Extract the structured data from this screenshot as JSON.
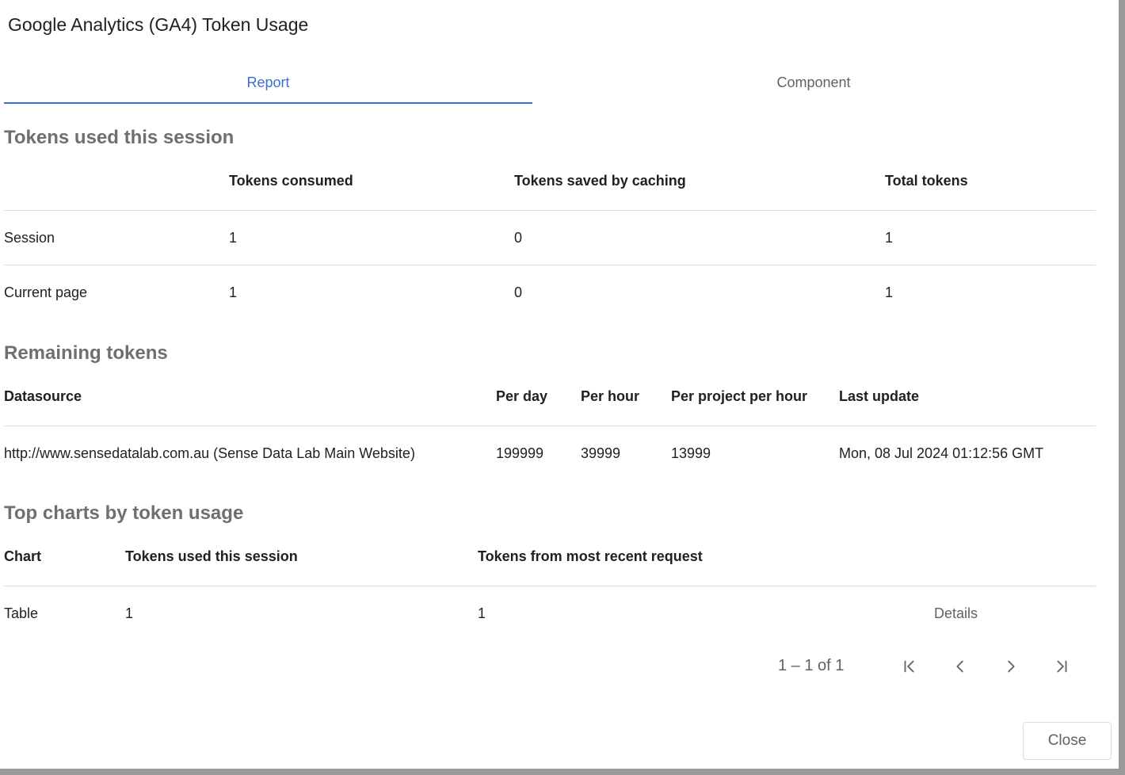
{
  "dialog": {
    "title": "Google Analytics (GA4) Token Usage"
  },
  "tabs": [
    {
      "label": "Report",
      "active": true
    },
    {
      "label": "Component",
      "active": false
    }
  ],
  "session_section": {
    "title": "Tokens used this session",
    "headers": [
      "",
      "Tokens consumed",
      "Tokens saved by caching",
      "Total tokens"
    ],
    "rows": [
      [
        "Session",
        "1",
        "0",
        "1"
      ],
      [
        "Current page",
        "1",
        "0",
        "1"
      ]
    ]
  },
  "remaining_section": {
    "title": "Remaining tokens",
    "headers": [
      "Datasource",
      "Per day",
      "Per hour",
      "Per project per hour",
      "Last update"
    ],
    "rows": [
      [
        "http://www.sensedatalab.com.au (Sense Data Lab Main Website)",
        "199999",
        "39999",
        "13999",
        "Mon, 08 Jul 2024 01:12:56 GMT"
      ]
    ]
  },
  "charts_section": {
    "title": "Top charts by token usage",
    "headers": [
      "Chart",
      "Tokens used this session",
      "Tokens from most recent request"
    ],
    "rows": [
      {
        "chart": "Table",
        "session": "1",
        "recent": "1",
        "action": "Details"
      }
    ]
  },
  "pagination": {
    "range_text": "1 – 1 of 1"
  },
  "footer": {
    "close_label": "Close"
  },
  "colors": {
    "accent": "#3b6fd4",
    "section_title": "#6f6f6f",
    "divider": "#dcdcdc"
  },
  "icons": [
    "first-page-icon",
    "chevron-left-icon",
    "chevron-right-icon",
    "last-page-icon"
  ]
}
